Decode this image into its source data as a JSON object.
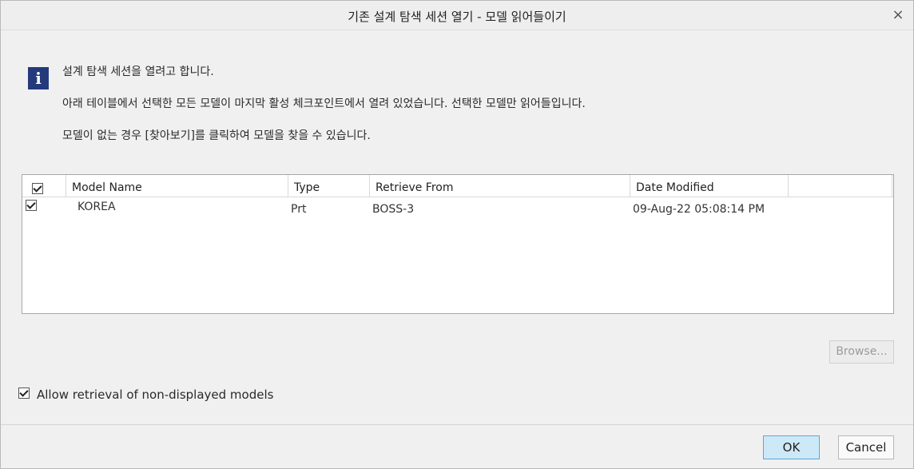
{
  "window": {
    "title": "기존 설계 탐색 세션 열기 - 모델 읽어들이기",
    "close_glyph": "×"
  },
  "info": {
    "icon_glyph": "i",
    "line1": "설계 탐색 세션을 열려고 합니다.",
    "line2": "아래 테이블에서 선택한 모든 모델이 마지막 활성 체크포인트에서 열려 있었습니다. 선택한 모델만 읽어들입니다.",
    "line3": "모델이 없는 경우 [찾아보기]를 클릭하여 모델을 찾을 수 있습니다."
  },
  "table": {
    "header_checked": true,
    "columns": {
      "name": "Model Name",
      "type": "Type",
      "from": "Retrieve From",
      "date": "Date Modified"
    },
    "rows": [
      {
        "checked": true,
        "name": "KOREA",
        "type": "Prt",
        "from": "BOSS-3",
        "date": "09-Aug-22 05:08:14 PM"
      }
    ]
  },
  "browse_label": "Browse...",
  "allow_retrieval": {
    "checked": true,
    "label": "Allow retrieval of non-displayed models"
  },
  "footer": {
    "ok_label": "OK",
    "cancel_label": "Cancel"
  },
  "colors": {
    "info_icon_bg": "#23397c",
    "ok_bg": "#cde8f7",
    "ok_border": "#56a9de",
    "dialog_bg": "#f0f0f0"
  }
}
